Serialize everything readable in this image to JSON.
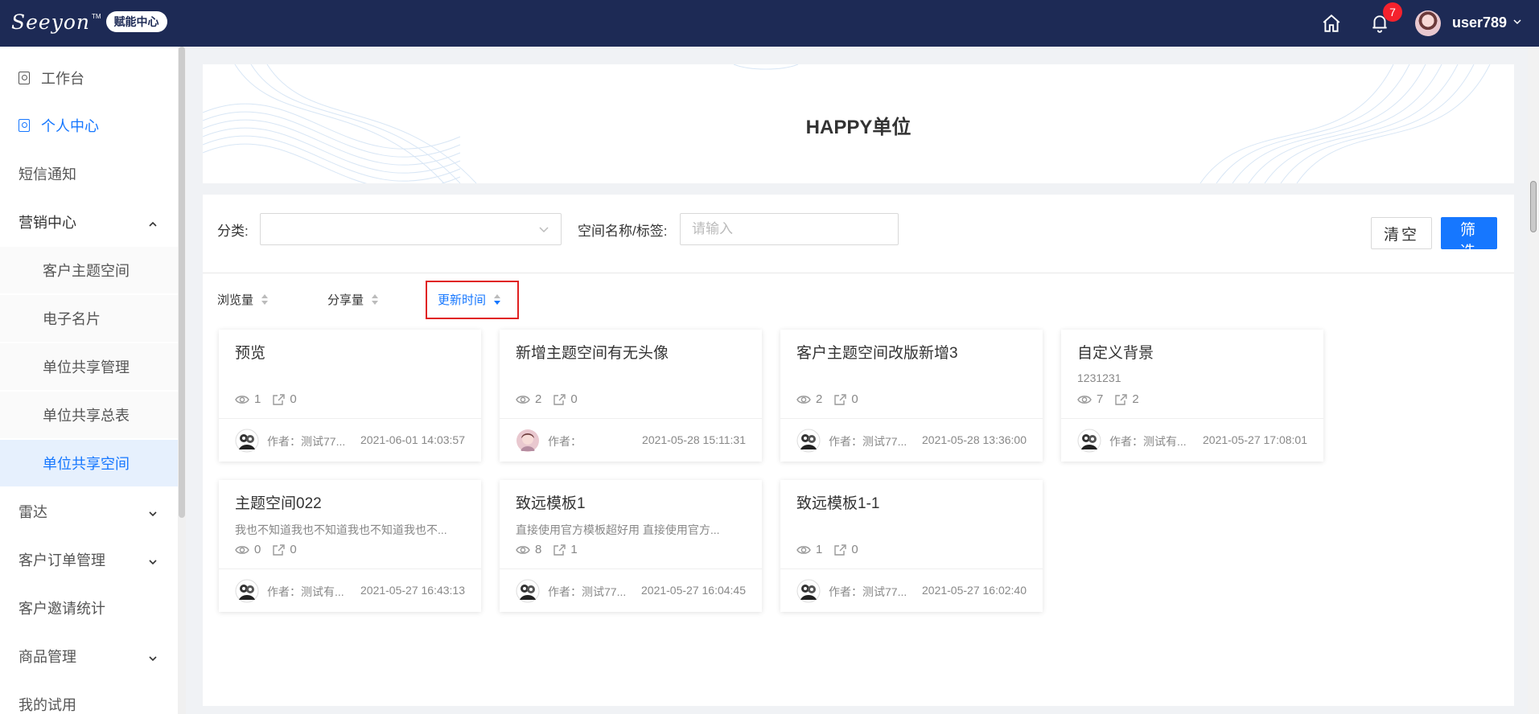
{
  "header": {
    "logo_text": "Seeyon",
    "logo_tm": "TM",
    "logo_badge": "赋能中心",
    "notification_count": "7",
    "username": "user789"
  },
  "sidebar": {
    "items": [
      {
        "label": "工作台"
      },
      {
        "label": "个人中心"
      },
      {
        "label": "短信通知"
      },
      {
        "label": "营销中心"
      },
      {
        "label": "客户主题空间"
      },
      {
        "label": "电子名片"
      },
      {
        "label": "单位共享管理"
      },
      {
        "label": "单位共享总表"
      },
      {
        "label": "单位共享空间"
      },
      {
        "label": "雷达"
      },
      {
        "label": "客户订单管理"
      },
      {
        "label": "客户邀请统计"
      },
      {
        "label": "商品管理"
      },
      {
        "label": "我的试用"
      }
    ]
  },
  "banner": {
    "title": "HAPPY单位"
  },
  "filters": {
    "category_label": "分类:",
    "category_value": "",
    "name_label": "空间名称/标签:",
    "name_placeholder": "请输入",
    "clear_label": "清空",
    "filter_label": "筛选"
  },
  "sort": {
    "views_label": "浏览量",
    "shares_label": "分享量",
    "updated_label": "更新时间"
  },
  "cards": [
    {
      "title": "预览",
      "desc": "",
      "views": "1",
      "shares": "0",
      "author": "作者：测试77...",
      "date": "2021-06-01 14:03:57"
    },
    {
      "title": "新增主题空间有无头像",
      "desc": "",
      "views": "2",
      "shares": "0",
      "author": "作者：",
      "date": "2021-05-28 15:11:31"
    },
    {
      "title": "客户主题空间改版新增3",
      "desc": "",
      "views": "2",
      "shares": "0",
      "author": "作者：测试77...",
      "date": "2021-05-28 13:36:00"
    },
    {
      "title": "自定义背景",
      "desc": "1231231",
      "views": "7",
      "shares": "2",
      "author": "作者：测试有...",
      "date": "2021-05-27 17:08:01"
    },
    {
      "title": "主题空间022",
      "desc": "我也不知道我也不知道我也不知道我也不...",
      "views": "0",
      "shares": "0",
      "author": "作者：测试有...",
      "date": "2021-05-27 16:43:13"
    },
    {
      "title": "致远模板1",
      "desc": "直接使用官方模板超好用 直接使用官方...",
      "views": "8",
      "shares": "1",
      "author": "作者：测试77...",
      "date": "2021-05-27 16:04:45"
    },
    {
      "title": "致远模板1-1",
      "desc": "",
      "views": "1",
      "shares": "0",
      "author": "作者：测试77...",
      "date": "2021-05-27 16:02:40"
    }
  ],
  "colors": {
    "topbar": "#1d2a55",
    "accent": "#1677ff",
    "highlight": "#e02020",
    "badge": "#f5222d"
  }
}
